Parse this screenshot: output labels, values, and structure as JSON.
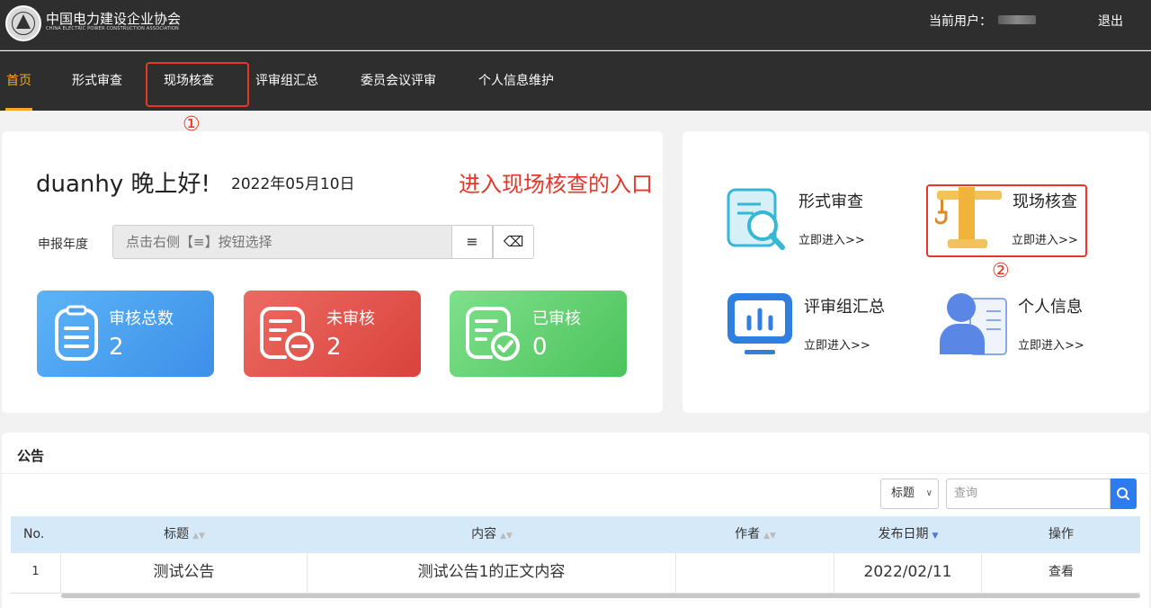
{
  "header": {
    "org_name_cn": "中国电力建设企业协会",
    "org_name_en": "CHINA ELECTRIC POWER CONSTRUCTION ASSOCIATION",
    "current_user_label": "当前用户：",
    "logout_label": "退出"
  },
  "nav": {
    "items": [
      {
        "label": "首页"
      },
      {
        "label": "形式审查"
      },
      {
        "label": "现场核查"
      },
      {
        "label": "评审组汇总"
      },
      {
        "label": "委员会议评审"
      },
      {
        "label": "个人信息维护"
      }
    ],
    "annotation_1": "①"
  },
  "welcome": {
    "greeting": "duanhy 晚上好!",
    "date": "2022年05月10日",
    "annotation": "进入现场核查的入口",
    "year_label": "申报年度",
    "year_placeholder": "点击右侧【≡】按钮选择",
    "menu_btn": "≡",
    "clear_btn": "⌫"
  },
  "stats": [
    {
      "label": "审核总数",
      "value": "2",
      "color": "#4a9ff0"
    },
    {
      "label": "未审核",
      "value": "2",
      "color": "#e0504a"
    },
    {
      "label": "已审核",
      "value": "0",
      "color": "#5fcf6e"
    }
  ],
  "quick_links": [
    {
      "title": "形式审查",
      "link": "立即进入>>",
      "icon": "review-doc-icon"
    },
    {
      "title": "现场核查",
      "link": "立即进入>>",
      "icon": "crane-icon"
    },
    {
      "title": "评审组汇总",
      "link": "立即进入>>",
      "icon": "monitor-chart-icon"
    },
    {
      "title": "个人信息",
      "link": "立即进入>>",
      "icon": "person-card-icon"
    }
  ],
  "annotation_2": "②",
  "notice": {
    "title": "公告",
    "filter_value": "标题",
    "search_placeholder": "查询",
    "columns": [
      "No.",
      "标题",
      "内容",
      "作者",
      "发布日期",
      "操作"
    ],
    "rows": [
      {
        "no": "1",
        "title": "测试公告",
        "content": "测试公告1的正文内容",
        "author": "",
        "date": "2022/02/11",
        "action": "查看"
      }
    ]
  },
  "colors": {
    "accent": "#f5a623",
    "highlight": "#e8352a",
    "header_bg": "#2e2e2e"
  }
}
